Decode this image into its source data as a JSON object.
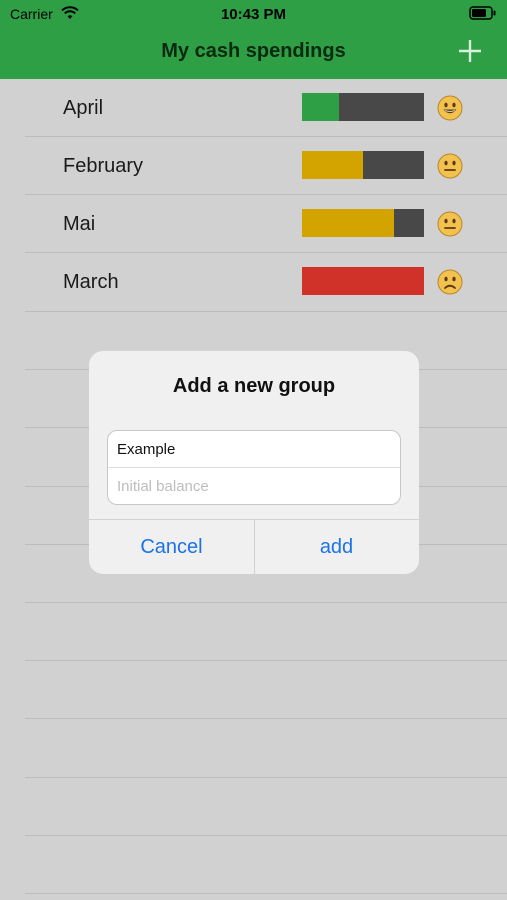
{
  "status_bar": {
    "carrier": "Carrier",
    "time": "10:43 PM",
    "wifi_icon": "wifi-icon",
    "battery_icon": "battery-icon"
  },
  "nav": {
    "title": "My cash spendings",
    "add_icon": "plus-icon"
  },
  "groups": [
    {
      "label": "April",
      "progress": 0.3,
      "color": "#2e9f45",
      "mood": "grinning-face"
    },
    {
      "label": "February",
      "progress": 0.5,
      "color": "#d3a400",
      "mood": "neutral-face"
    },
    {
      "label": "Mai",
      "progress": 0.75,
      "color": "#d3a400",
      "mood": "neutral-face"
    },
    {
      "label": "March",
      "progress": 1.0,
      "color": "#d03128",
      "mood": "frowning-face"
    }
  ],
  "dialog": {
    "title": "Add a new group",
    "name_value": "Example",
    "balance_placeholder": "Initial balance",
    "cancel_label": "Cancel",
    "add_label": "add"
  },
  "colors": {
    "header": "#2e9f45",
    "accent": "#1a73e8",
    "background": "#d1d1d1"
  }
}
